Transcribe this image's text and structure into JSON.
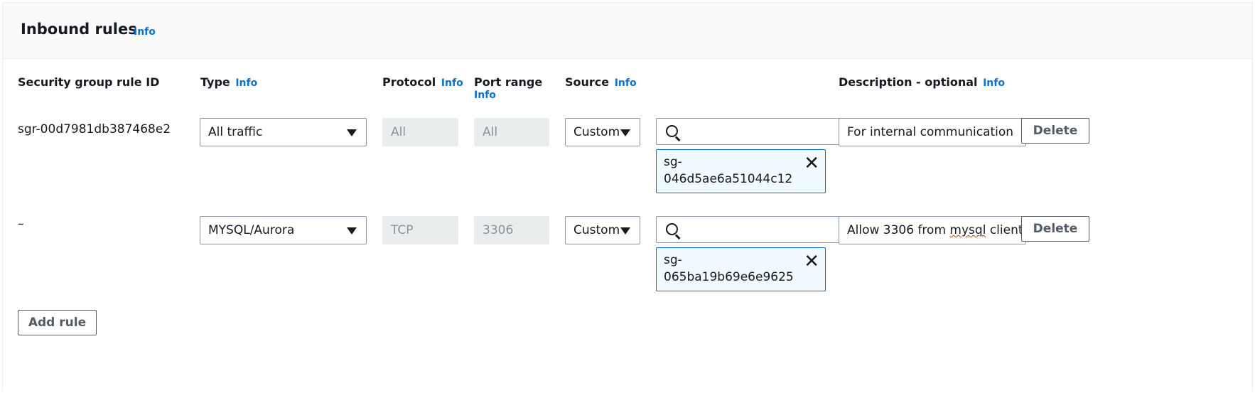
{
  "header": {
    "title": "Inbound rules",
    "info": "Info"
  },
  "columns": {
    "rule_id": "Security group rule ID",
    "type": "Type",
    "protocol": "Protocol",
    "port_range": "Port range",
    "source": "Source",
    "description": "Description - optional",
    "info": "Info"
  },
  "rules": [
    {
      "rule_id": "sgr-00d7981db387468e2",
      "type": "All traffic",
      "protocol": "All",
      "port_range": "All",
      "source_type": "Custom",
      "search_value": "",
      "source_token_line1": "sg-",
      "source_token_line2": "046d5ae6a51044c12",
      "description": "For internal communication",
      "delete_label": "Delete"
    },
    {
      "rule_id": "–",
      "type": "MYSQL/Aurora",
      "protocol": "TCP",
      "port_range": "3306",
      "source_type": "Custom",
      "search_value": "",
      "source_token_line1": "sg-",
      "source_token_line2": "065ba19b69e6e9625",
      "description_before": "Allow 3306 from ",
      "description_misspelled": "mysql",
      "description_after": " client",
      "delete_label": "Delete"
    }
  ],
  "add_rule_label": "Add rule",
  "colors": {
    "accent": "#0972d3",
    "token_bg": "#f1faff",
    "disabled_bg": "#eaeded"
  },
  "icons": {
    "search": "search-icon",
    "dismiss": "close-icon",
    "dropdown": "caret-down-icon"
  }
}
